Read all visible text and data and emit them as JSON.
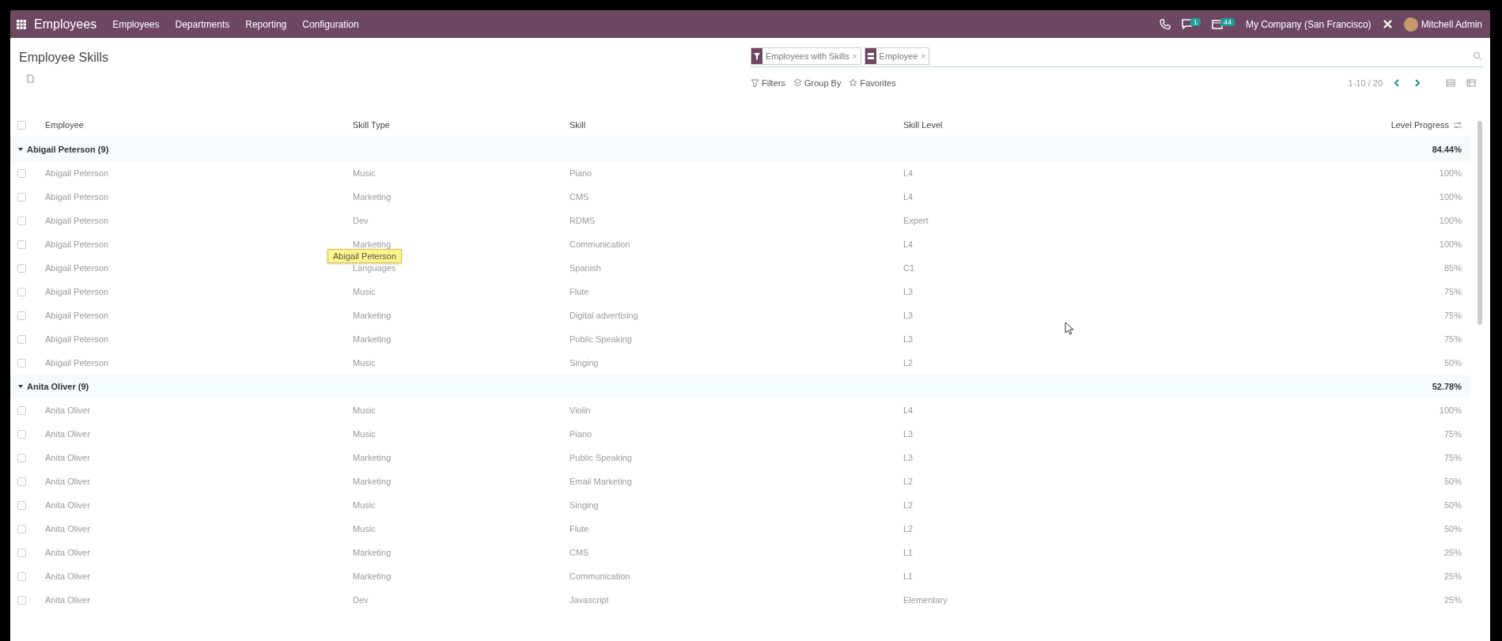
{
  "navbar": {
    "app_name": "Employees",
    "menu": [
      "Employees",
      "Departments",
      "Reporting",
      "Configuration"
    ],
    "messages_badge": "1",
    "activities_badge": "44",
    "company": "My Company (San Francisco)",
    "user": "Mitchell Admin"
  },
  "control_panel": {
    "title": "Employee Skills",
    "facets": [
      {
        "kind": "filter",
        "label": "Employees with Skills",
        "remove": "×"
      },
      {
        "kind": "group",
        "label": "Employee",
        "remove": "×"
      }
    ],
    "search_menus": [
      {
        "kind": "filter",
        "label": "Filters"
      },
      {
        "kind": "group",
        "label": "Group By"
      },
      {
        "kind": "favorites",
        "label": "Favorites"
      }
    ],
    "pager": "1-10 / 20"
  },
  "table": {
    "columns": [
      "Employee",
      "Skill Type",
      "Skill",
      "Skill Level",
      "Level Progress"
    ],
    "header_checked": false,
    "groups": [
      {
        "name": "Abigail Peterson (9)",
        "expanded": true,
        "total": "84.44%",
        "rows": [
          {
            "employee": "Abigail Peterson",
            "skill_type": "Music",
            "skill": "Piano",
            "skill_level": "L4",
            "progress": "100%",
            "checked": false
          },
          {
            "employee": "Abigail Peterson",
            "skill_type": "Marketing",
            "skill": "CMS",
            "skill_level": "L4",
            "progress": "100%",
            "checked": false
          },
          {
            "employee": "Abigail Peterson",
            "skill_type": "Dev",
            "skill": "RDMS",
            "skill_level": "Expert",
            "progress": "100%",
            "checked": false
          },
          {
            "employee": "Abigail Peterson",
            "skill_type": "Marketing",
            "skill": "Communication",
            "skill_level": "L4",
            "progress": "100%",
            "checked": false
          },
          {
            "employee": "Abigail Peterson",
            "skill_type": "Languages",
            "skill": "Spanish",
            "skill_level": "C1",
            "progress": "85%",
            "checked": false
          },
          {
            "employee": "Abigail Peterson",
            "skill_type": "Music",
            "skill": "Flute",
            "skill_level": "L3",
            "progress": "75%",
            "checked": false
          },
          {
            "employee": "Abigail Peterson",
            "skill_type": "Marketing",
            "skill": "Digital advertising",
            "skill_level": "L3",
            "progress": "75%",
            "checked": false
          },
          {
            "employee": "Abigail Peterson",
            "skill_type": "Marketing",
            "skill": "Public Speaking",
            "skill_level": "L3",
            "progress": "75%",
            "checked": false
          },
          {
            "employee": "Abigail Peterson",
            "skill_type": "Music",
            "skill": "Singing",
            "skill_level": "L2",
            "progress": "50%",
            "checked": false
          }
        ]
      },
      {
        "name": "Anita Oliver (9)",
        "expanded": true,
        "total": "52.78%",
        "rows": [
          {
            "employee": "Anita Oliver",
            "skill_type": "Music",
            "skill": "Violin",
            "skill_level": "L4",
            "progress": "100%",
            "checked": false
          },
          {
            "employee": "Anita Oliver",
            "skill_type": "Music",
            "skill": "Piano",
            "skill_level": "L3",
            "progress": "75%",
            "checked": false
          },
          {
            "employee": "Anita Oliver",
            "skill_type": "Marketing",
            "skill": "Public Speaking",
            "skill_level": "L3",
            "progress": "75%",
            "checked": false
          },
          {
            "employee": "Anita Oliver",
            "skill_type": "Marketing",
            "skill": "Email Marketing",
            "skill_level": "L2",
            "progress": "50%",
            "checked": false
          },
          {
            "employee": "Anita Oliver",
            "skill_type": "Music",
            "skill": "Singing",
            "skill_level": "L2",
            "progress": "50%",
            "checked": false
          },
          {
            "employee": "Anita Oliver",
            "skill_type": "Music",
            "skill": "Flute",
            "skill_level": "L2",
            "progress": "50%",
            "checked": false
          },
          {
            "employee": "Anita Oliver",
            "skill_type": "Marketing",
            "skill": "CMS",
            "skill_level": "L1",
            "progress": "25%",
            "checked": false
          },
          {
            "employee": "Anita Oliver",
            "skill_type": "Marketing",
            "skill": "Communication",
            "skill_level": "L1",
            "progress": "25%",
            "checked": false
          },
          {
            "employee": "Anita Oliver",
            "skill_type": "Dev",
            "skill": "Javascript",
            "skill_level": "Elementary",
            "progress": "25%",
            "checked": false
          }
        ]
      }
    ]
  },
  "tooltip": {
    "text": "Abigail Peterson"
  }
}
